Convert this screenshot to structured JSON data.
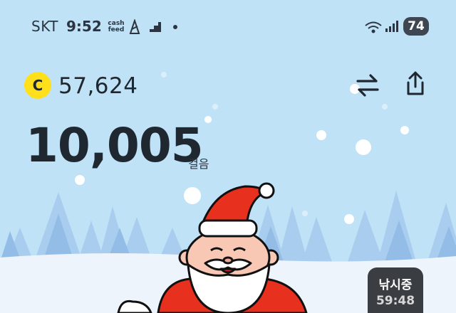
{
  "status_bar": {
    "carrier": "SKT",
    "time": "9:52",
    "cashfeed_label": "cash feed",
    "battery": "74",
    "icons": [
      "cashfeed-icon",
      "cash-walk-icon",
      "stairs-icon",
      "notification-dot-icon",
      "wifi-icon",
      "signal-icon",
      "battery-icon"
    ]
  },
  "header": {
    "coin_symbol": "C",
    "coin_balance": "57,624",
    "exchange_icon": "exchange-arrows-icon",
    "share_icon": "share-icon"
  },
  "steps": {
    "count": "10,005",
    "unit": "걸음"
  },
  "fishing_badge": {
    "title": "낚시중",
    "timer": "59:48"
  },
  "colors": {
    "sky": "#bfe2f6",
    "snow_ground": "#eef4fb",
    "tree": "#9ec6ea",
    "coin_yellow": "#ffe01b",
    "santa_red": "#e8301e",
    "badge_dark": "#3a3d42",
    "text_dark": "#1f2730"
  }
}
